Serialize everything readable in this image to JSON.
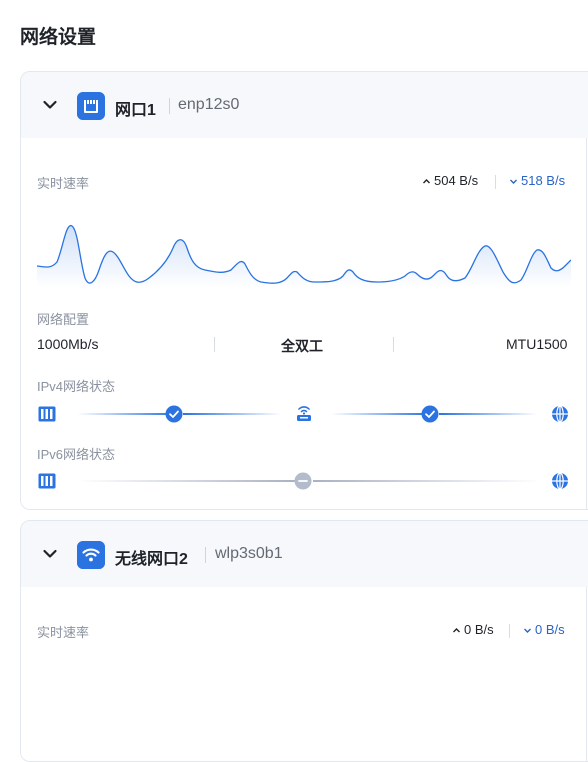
{
  "page": {
    "title": "网络设置"
  },
  "interfaces": [
    {
      "name": "网口1",
      "device": "enp12s0",
      "realtime_label": "实时速率",
      "upload": "504 B/s",
      "download": "518 B/s",
      "config_label": "网络配置",
      "config": {
        "speed": "1000Mb/s",
        "duplex": "全双工",
        "mtu": "MTU1500"
      },
      "ipv4_label": "IPv4网络状态",
      "ipv6_label": "IPv6网络状态"
    },
    {
      "name": "无线网口2",
      "device": "wlp3s0b1",
      "realtime_label": "实时速率",
      "upload": "0 B/s",
      "download": "0 B/s"
    }
  ],
  "colors": {
    "accent": "#2a73e0",
    "download": "#2a63c7",
    "muted": "#8a919f",
    "disabled": "#b4bccb"
  },
  "icons": {
    "collapse": "chevron-down-icon",
    "wired": "ethernet-port-icon",
    "wireless": "wifi-icon",
    "device": "server-icon",
    "router": "router-icon",
    "internet": "globe-icon",
    "ok": "check-circle-icon",
    "na": "minus-circle-icon"
  }
}
